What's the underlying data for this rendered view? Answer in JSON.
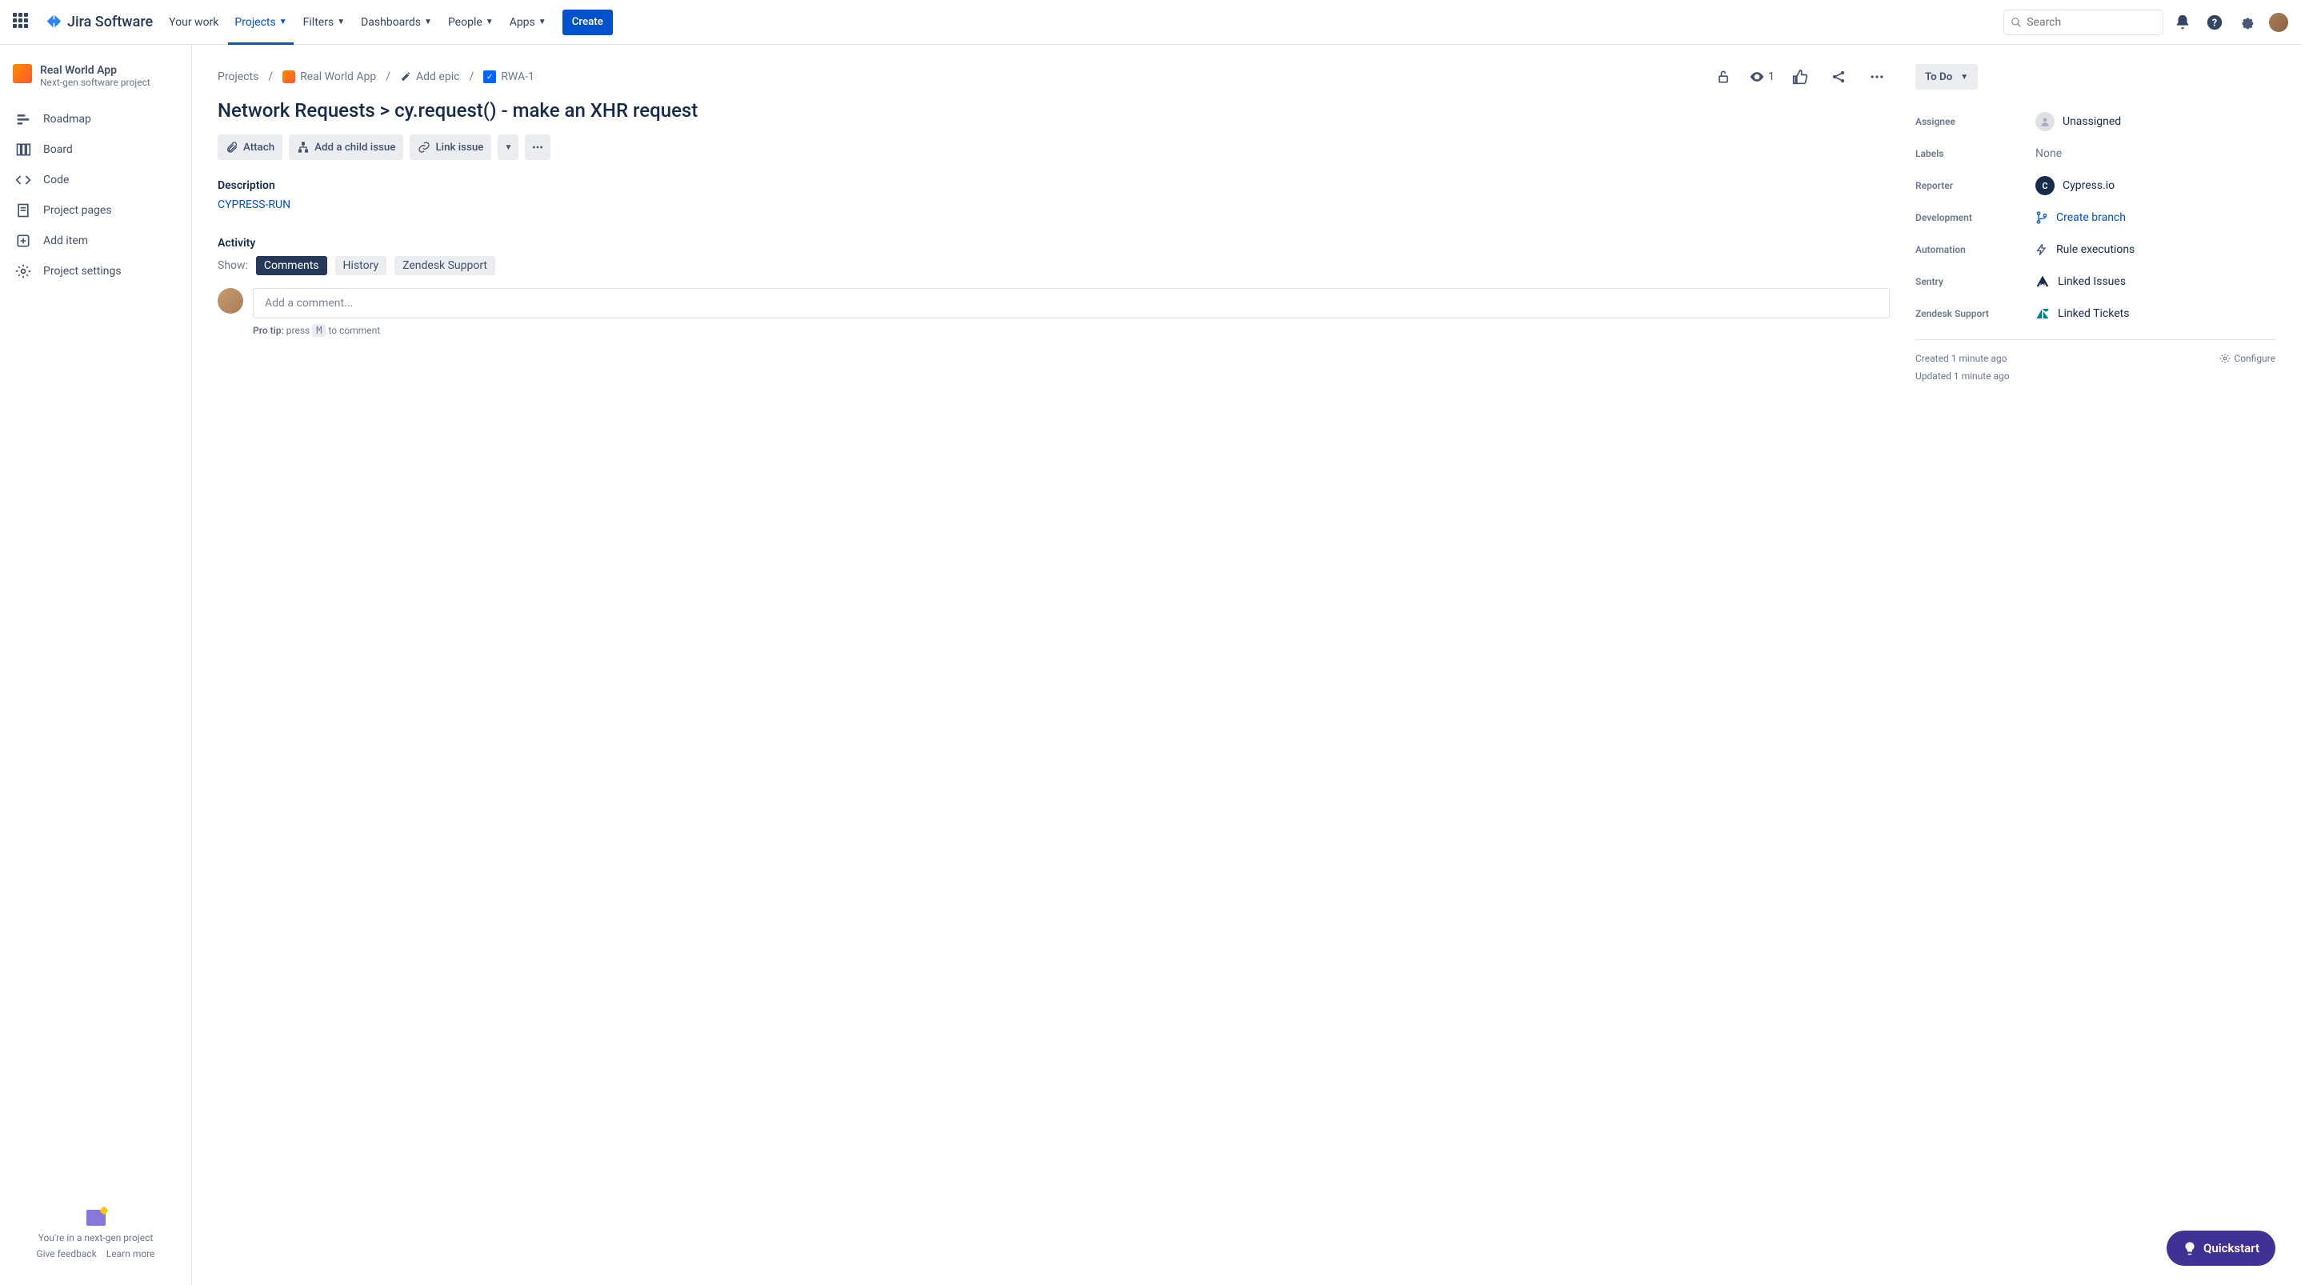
{
  "nav": {
    "logo": "Jira Software",
    "items": [
      "Your work",
      "Projects",
      "Filters",
      "Dashboards",
      "People",
      "Apps"
    ],
    "create": "Create",
    "search_placeholder": "Search"
  },
  "sidebar": {
    "project_name": "Real World App",
    "project_subtitle": "Next-gen software project",
    "items": [
      {
        "label": "Roadmap",
        "icon": "roadmap"
      },
      {
        "label": "Board",
        "icon": "board"
      },
      {
        "label": "Code",
        "icon": "code"
      },
      {
        "label": "Project pages",
        "icon": "pages"
      },
      {
        "label": "Add item",
        "icon": "add"
      },
      {
        "label": "Project settings",
        "icon": "settings"
      }
    ],
    "footer_text": "You're in a next-gen project",
    "footer_feedback": "Give feedback",
    "footer_learn": "Learn more"
  },
  "breadcrumb": {
    "root": "Projects",
    "project": "Real World App",
    "epic_action": "Add epic",
    "issue_key": "RWA-1"
  },
  "issue": {
    "title": "Network Requests > cy.request() - make an XHR request",
    "actions": {
      "attach": "Attach",
      "add_child": "Add a child issue",
      "link": "Link issue"
    },
    "description_label": "Description",
    "description_content": "CYPRESS-RUN",
    "activity_label": "Activity",
    "show_label": "Show:",
    "filters": [
      "Comments",
      "History",
      "Zendesk Support"
    ],
    "comment_placeholder": "Add a comment...",
    "pro_tip_label": "Pro tip:",
    "pro_tip_press": "press",
    "pro_tip_key": "M",
    "pro_tip_rest": "to comment"
  },
  "details": {
    "status": "To Do",
    "watchers": "1",
    "fields": {
      "assignee_label": "Assignee",
      "assignee_value": "Unassigned",
      "labels_label": "Labels",
      "labels_value": "None",
      "reporter_label": "Reporter",
      "reporter_value": "Cypress.io",
      "reporter_initial": "C",
      "development_label": "Development",
      "development_value": "Create branch",
      "automation_label": "Automation",
      "automation_value": "Rule executions",
      "sentry_label": "Sentry",
      "sentry_value": "Linked Issues",
      "zendesk_label": "Zendesk Support",
      "zendesk_value": "Linked Tickets"
    },
    "created": "Created 1 minute ago",
    "updated": "Updated 1 minute ago",
    "configure": "Configure"
  },
  "quickstart": "Quickstart"
}
